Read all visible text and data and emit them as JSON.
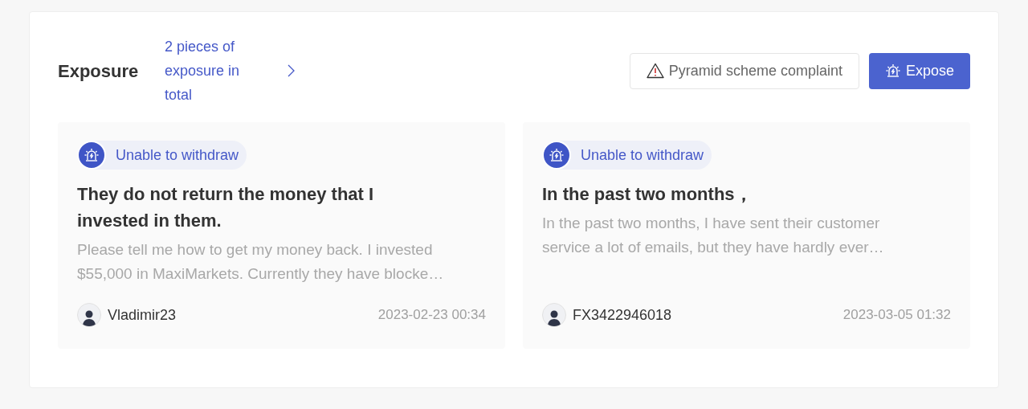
{
  "header": {
    "title": "Exposure",
    "count_link": "2 pieces of exposure in total",
    "buttons": [
      {
        "kind": "outline",
        "label": "Pyramid scheme complaint"
      },
      {
        "kind": "primary",
        "label": "Expose"
      }
    ]
  },
  "cards": [
    {
      "tag": "Unable to withdraw",
      "title": "They do not return the money that I invested in them.",
      "body": [
        "Please tell me how to get my money back. I invested",
        "$55,000 in MaxiMarkets. Currently they have blocke…"
      ],
      "user": "Vladimir23",
      "time": "2023-02-23 00:34"
    },
    {
      "tag": "Unable to withdraw",
      "title": "In the past two months，",
      "body": [
        "In the past two months, I have sent their customer",
        "service a lot of emails, but they have hardly ever…"
      ],
      "user": "FX3422946018",
      "time": "2023-03-05 01:32"
    }
  ]
}
